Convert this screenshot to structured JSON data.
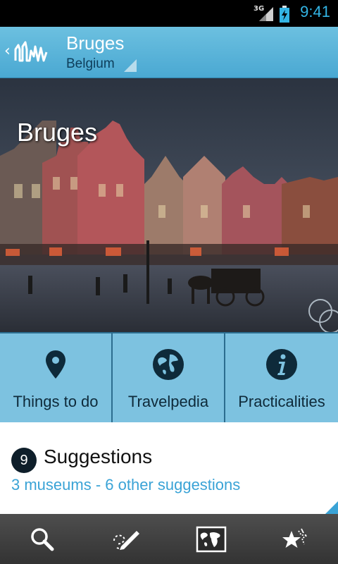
{
  "status_bar": {
    "network": "3G",
    "time": "9:41"
  },
  "action_bar": {
    "title": "Bruges",
    "subtitle": "Belgium"
  },
  "hero": {
    "title": "Bruges"
  },
  "tiles": [
    {
      "label": "Things to do",
      "icon": "map-pin-icon"
    },
    {
      "label": "Travelpedia",
      "icon": "globe-icon"
    },
    {
      "label": "Practicalities",
      "icon": "info-icon"
    }
  ],
  "suggestions": {
    "count": "9",
    "heading": "Suggestions",
    "detail": "3 museums - 6 other suggestions"
  },
  "bottom_nav": [
    {
      "icon": "search-icon"
    },
    {
      "icon": "edit-route-icon"
    },
    {
      "icon": "world-map-icon"
    },
    {
      "icon": "favorite-stars-icon"
    }
  ],
  "colors": {
    "accent": "#4aa8d2",
    "tile": "#7dc2e0",
    "link": "#3aa3d6",
    "clock": "#33b5e5"
  }
}
